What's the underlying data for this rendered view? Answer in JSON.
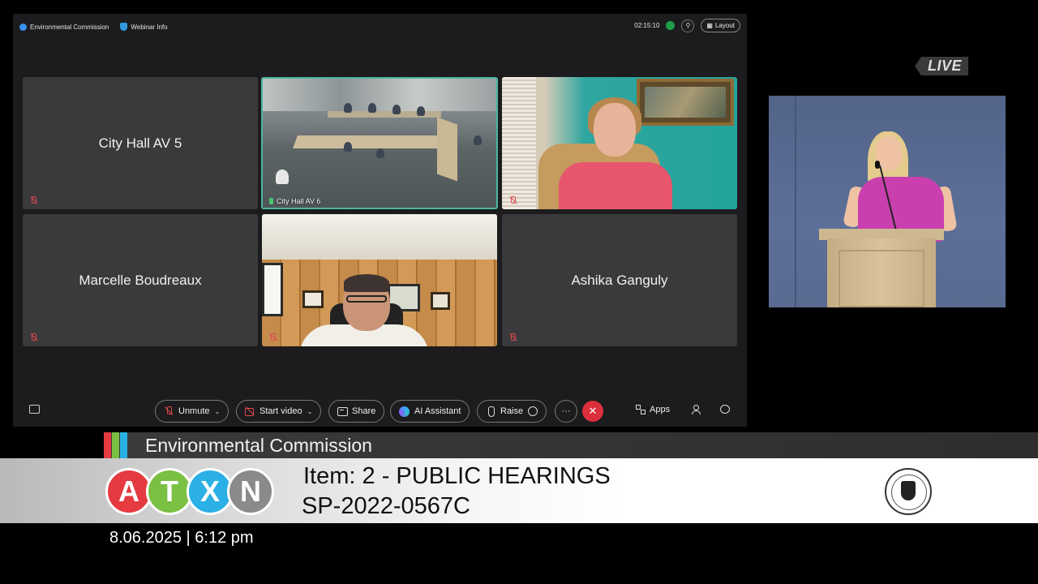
{
  "topbar": {
    "meeting_name": "Environmental Commission",
    "webinar_info": "Webinar Info",
    "timer": "02:15:10",
    "layout_label": "Layout"
  },
  "tiles": [
    {
      "name": "City Hall AV 5",
      "video": false,
      "muted": true
    },
    {
      "name": "City Hall AV 6",
      "video": true,
      "active": true
    },
    {
      "name": "",
      "video": true,
      "muted": true
    },
    {
      "name": "Marcelle Boudreaux",
      "video": false,
      "muted": true
    },
    {
      "name": "",
      "video": true,
      "muted": true
    },
    {
      "name": "Ashika Ganguly",
      "video": false,
      "muted": true
    }
  ],
  "controls": {
    "unmute": "Unmute",
    "start_video": "Start video",
    "share": "Share",
    "ai_assistant": "AI Assistant",
    "raise": "Raise",
    "more": "···",
    "end": "✕",
    "apps": "Apps"
  },
  "live_badge": "LIVE",
  "lower_third": {
    "channel": "Environmental Commission",
    "logo_letters": [
      "A",
      "T",
      "X",
      "N"
    ],
    "logo_colors": [
      "#e53a40",
      "#7ac043",
      "#2ab0e4",
      "#8a8a8a"
    ],
    "stripe_colors": [
      "#e53a40",
      "#7ac043",
      "#2ab0e4"
    ],
    "item": "Item: 2 - PUBLIC HEARINGS",
    "case_number": "SP-2022-0567C",
    "datetime": "8.06.2025 | 6:12 pm"
  },
  "colors": {
    "webex_bg": "#1c1c1e",
    "tile_bg": "#3a3a3c",
    "active_border": "#4cb5a0",
    "end_call": "#dc2f3c"
  }
}
